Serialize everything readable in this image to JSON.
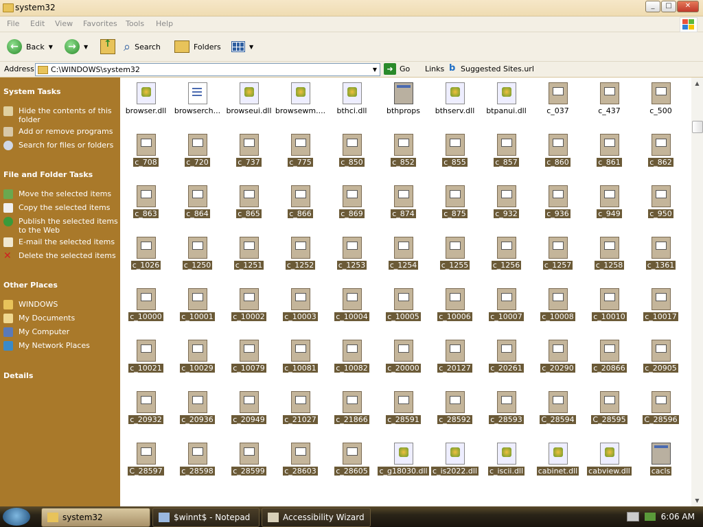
{
  "window": {
    "title": "system32"
  },
  "menu": [
    "File",
    "Edit",
    "View",
    "Favorites",
    "Tools",
    "Help"
  ],
  "toolbar": {
    "back": "Back",
    "search": "Search",
    "folders": "Folders"
  },
  "address": {
    "label": "Address",
    "value": "C:\\WINDOWS\\system32",
    "go": "Go",
    "links": "Links",
    "suggested": "Suggested Sites.url"
  },
  "sidebar": {
    "system_tasks": {
      "heading": "System Tasks",
      "items": [
        "Hide the contents of this folder",
        "Add or remove programs",
        "Search for files or folders"
      ]
    },
    "file_tasks": {
      "heading": "File and Folder Tasks",
      "items": [
        "Move the selected items",
        "Copy the selected items",
        "Publish the selected items to the Web",
        "E-mail the selected items",
        "Delete the selected items"
      ]
    },
    "other_places": {
      "heading": "Other Places",
      "items": [
        "WINDOWS",
        "My Documents",
        "My Computer",
        "My Network Places"
      ]
    },
    "details": {
      "heading": "Details"
    }
  },
  "files": [
    {
      "name": "browser.dll",
      "type": "dll",
      "selected": false
    },
    {
      "name": "browserch...",
      "type": "txt",
      "selected": false
    },
    {
      "name": "browseui.dll",
      "type": "dll",
      "selected": false
    },
    {
      "name": "browsewm....",
      "type": "dll",
      "selected": false
    },
    {
      "name": "bthci.dll",
      "type": "dll",
      "selected": false
    },
    {
      "name": "bthprops",
      "type": "app",
      "selected": false
    },
    {
      "name": "bthserv.dll",
      "type": "dll",
      "selected": false
    },
    {
      "name": "btpanui.dll",
      "type": "dll",
      "selected": false
    },
    {
      "name": "c_037",
      "type": "c",
      "selected": false
    },
    {
      "name": "c_437",
      "type": "c",
      "selected": false
    },
    {
      "name": "c_500",
      "type": "c",
      "selected": false
    },
    {
      "name": "c_708",
      "type": "c",
      "selected": true
    },
    {
      "name": "c_720",
      "type": "c",
      "selected": true
    },
    {
      "name": "c_737",
      "type": "c",
      "selected": true
    },
    {
      "name": "c_775",
      "type": "c",
      "selected": true
    },
    {
      "name": "c_850",
      "type": "c",
      "selected": true
    },
    {
      "name": "c_852",
      "type": "c",
      "selected": true
    },
    {
      "name": "c_855",
      "type": "c",
      "selected": true
    },
    {
      "name": "c_857",
      "type": "c",
      "selected": true
    },
    {
      "name": "c_860",
      "type": "c",
      "selected": true
    },
    {
      "name": "c_861",
      "type": "c",
      "selected": true
    },
    {
      "name": "c_862",
      "type": "c",
      "selected": true
    },
    {
      "name": "c_863",
      "type": "c",
      "selected": true
    },
    {
      "name": "c_864",
      "type": "c",
      "selected": true
    },
    {
      "name": "c_865",
      "type": "c",
      "selected": true
    },
    {
      "name": "c_866",
      "type": "c",
      "selected": true
    },
    {
      "name": "c_869",
      "type": "c",
      "selected": true
    },
    {
      "name": "c_874",
      "type": "c",
      "selected": true
    },
    {
      "name": "c_875",
      "type": "c",
      "selected": true
    },
    {
      "name": "c_932",
      "type": "c",
      "selected": true
    },
    {
      "name": "c_936",
      "type": "c",
      "selected": true
    },
    {
      "name": "c_949",
      "type": "c",
      "selected": true
    },
    {
      "name": "c_950",
      "type": "c",
      "selected": true
    },
    {
      "name": "c_1026",
      "type": "c",
      "selected": true
    },
    {
      "name": "c_1250",
      "type": "c",
      "selected": true
    },
    {
      "name": "c_1251",
      "type": "c",
      "selected": true
    },
    {
      "name": "c_1252",
      "type": "c",
      "selected": true
    },
    {
      "name": "c_1253",
      "type": "c",
      "selected": true
    },
    {
      "name": "c_1254",
      "type": "c",
      "selected": true
    },
    {
      "name": "c_1255",
      "type": "c",
      "selected": true
    },
    {
      "name": "c_1256",
      "type": "c",
      "selected": true
    },
    {
      "name": "c_1257",
      "type": "c",
      "selected": true
    },
    {
      "name": "c_1258",
      "type": "c",
      "selected": true
    },
    {
      "name": "c_1361",
      "type": "c",
      "selected": true
    },
    {
      "name": "c_10000",
      "type": "c",
      "selected": true
    },
    {
      "name": "c_10001",
      "type": "c",
      "selected": true
    },
    {
      "name": "c_10002",
      "type": "c",
      "selected": true
    },
    {
      "name": "c_10003",
      "type": "c",
      "selected": true
    },
    {
      "name": "c_10004",
      "type": "c",
      "selected": true
    },
    {
      "name": "c_10005",
      "type": "c",
      "selected": true
    },
    {
      "name": "c_10006",
      "type": "c",
      "selected": true
    },
    {
      "name": "c_10007",
      "type": "c",
      "selected": true
    },
    {
      "name": "c_10008",
      "type": "c",
      "selected": true
    },
    {
      "name": "c_10010",
      "type": "c",
      "selected": true
    },
    {
      "name": "c_10017",
      "type": "c",
      "selected": true
    },
    {
      "name": "c_10021",
      "type": "c",
      "selected": true
    },
    {
      "name": "c_10029",
      "type": "c",
      "selected": true
    },
    {
      "name": "c_10079",
      "type": "c",
      "selected": true
    },
    {
      "name": "c_10081",
      "type": "c",
      "selected": true
    },
    {
      "name": "c_10082",
      "type": "c",
      "selected": true
    },
    {
      "name": "c_20000",
      "type": "c",
      "selected": true
    },
    {
      "name": "c_20127",
      "type": "c",
      "selected": true
    },
    {
      "name": "c_20261",
      "type": "c",
      "selected": true
    },
    {
      "name": "c_20290",
      "type": "c",
      "selected": true
    },
    {
      "name": "c_20866",
      "type": "c",
      "selected": true
    },
    {
      "name": "c_20905",
      "type": "c",
      "selected": true
    },
    {
      "name": "c_20932",
      "type": "c",
      "selected": true
    },
    {
      "name": "c_20936",
      "type": "c",
      "selected": true
    },
    {
      "name": "c_20949",
      "type": "c",
      "selected": true
    },
    {
      "name": "c_21027",
      "type": "c",
      "selected": true
    },
    {
      "name": "c_21866",
      "type": "c",
      "selected": true
    },
    {
      "name": "c_28591",
      "type": "c",
      "selected": true
    },
    {
      "name": "c_28592",
      "type": "c",
      "selected": true
    },
    {
      "name": "c_28593",
      "type": "c",
      "selected": true
    },
    {
      "name": "C_28594",
      "type": "c",
      "selected": true
    },
    {
      "name": "C_28595",
      "type": "c",
      "selected": true
    },
    {
      "name": "C_28596",
      "type": "c",
      "selected": true
    },
    {
      "name": "C_28597",
      "type": "c",
      "selected": true
    },
    {
      "name": "c_28598",
      "type": "c",
      "selected": true
    },
    {
      "name": "c_28599",
      "type": "c",
      "selected": true
    },
    {
      "name": "c_28603",
      "type": "c",
      "selected": true
    },
    {
      "name": "c_28605",
      "type": "c",
      "selected": true
    },
    {
      "name": "c_g18030.dll",
      "type": "dll",
      "selected": true
    },
    {
      "name": "c_is2022.dll",
      "type": "dll",
      "selected": true
    },
    {
      "name": "c_iscii.dll",
      "type": "dll",
      "selected": true
    },
    {
      "name": "cabinet.dll",
      "type": "dll",
      "selected": true
    },
    {
      "name": "cabview.dll",
      "type": "dll",
      "selected": true
    },
    {
      "name": "cacls",
      "type": "app",
      "selected": true
    }
  ],
  "taskbar": {
    "items": [
      "system32",
      "$winnt$ - Notepad",
      "Accessibility Wizard"
    ],
    "clock": "6:06 AM"
  }
}
